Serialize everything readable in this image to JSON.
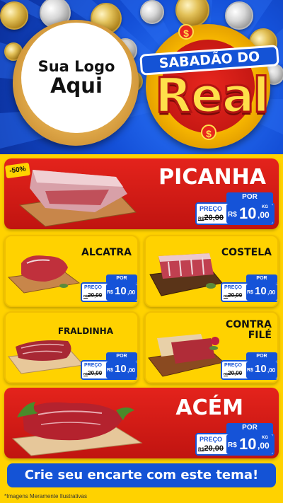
{
  "header": {
    "logo_line1": "Sua Logo",
    "logo_line2": "Aqui",
    "title_top": "SABADÃO DO",
    "title_big": "Real",
    "dollar_sign": "$"
  },
  "badge": "-50%",
  "price_common": {
    "por": "POR",
    "preco": "PREÇO",
    "currency": "R$",
    "unit": "KG",
    "old_prefix": "R$"
  },
  "products": [
    {
      "name": "PICANHA",
      "old_price": "20,00",
      "new_int": "10",
      "new_dec": ",00",
      "tag_color": "#1553d8"
    },
    {
      "name": "ALCATRA",
      "old_price": "20,00",
      "new_int": "10",
      "new_dec": ",00",
      "tag_color": "#1553d8"
    },
    {
      "name": "COSTELA",
      "old_price": "20,00",
      "new_int": "10",
      "new_dec": ",00",
      "tag_color": "#1553d8"
    },
    {
      "name": "FRALDINHA",
      "old_price": "20,00",
      "new_int": "10",
      "new_dec": ",00",
      "tag_color": "#1553d8"
    },
    {
      "name": "CONTRA FILÉ",
      "name_line1": "CONTRA",
      "name_line2": "FILÉ",
      "old_price": "20,00",
      "new_int": "10",
      "new_dec": ",00",
      "tag_color": "#1553d8"
    },
    {
      "name": "ACÉM",
      "old_price": "20,00",
      "new_int": "10",
      "new_dec": ",00",
      "tag_color": "#1553d8"
    }
  ],
  "footer": {
    "cta": "Crie seu encarte com este tema!",
    "disclaimer": "*Imagens Meramente Ilustrativas"
  },
  "colors": {
    "brand_blue": "#1453d6",
    "brand_red": "#e4231c",
    "brand_yellow": "#ffd200"
  }
}
